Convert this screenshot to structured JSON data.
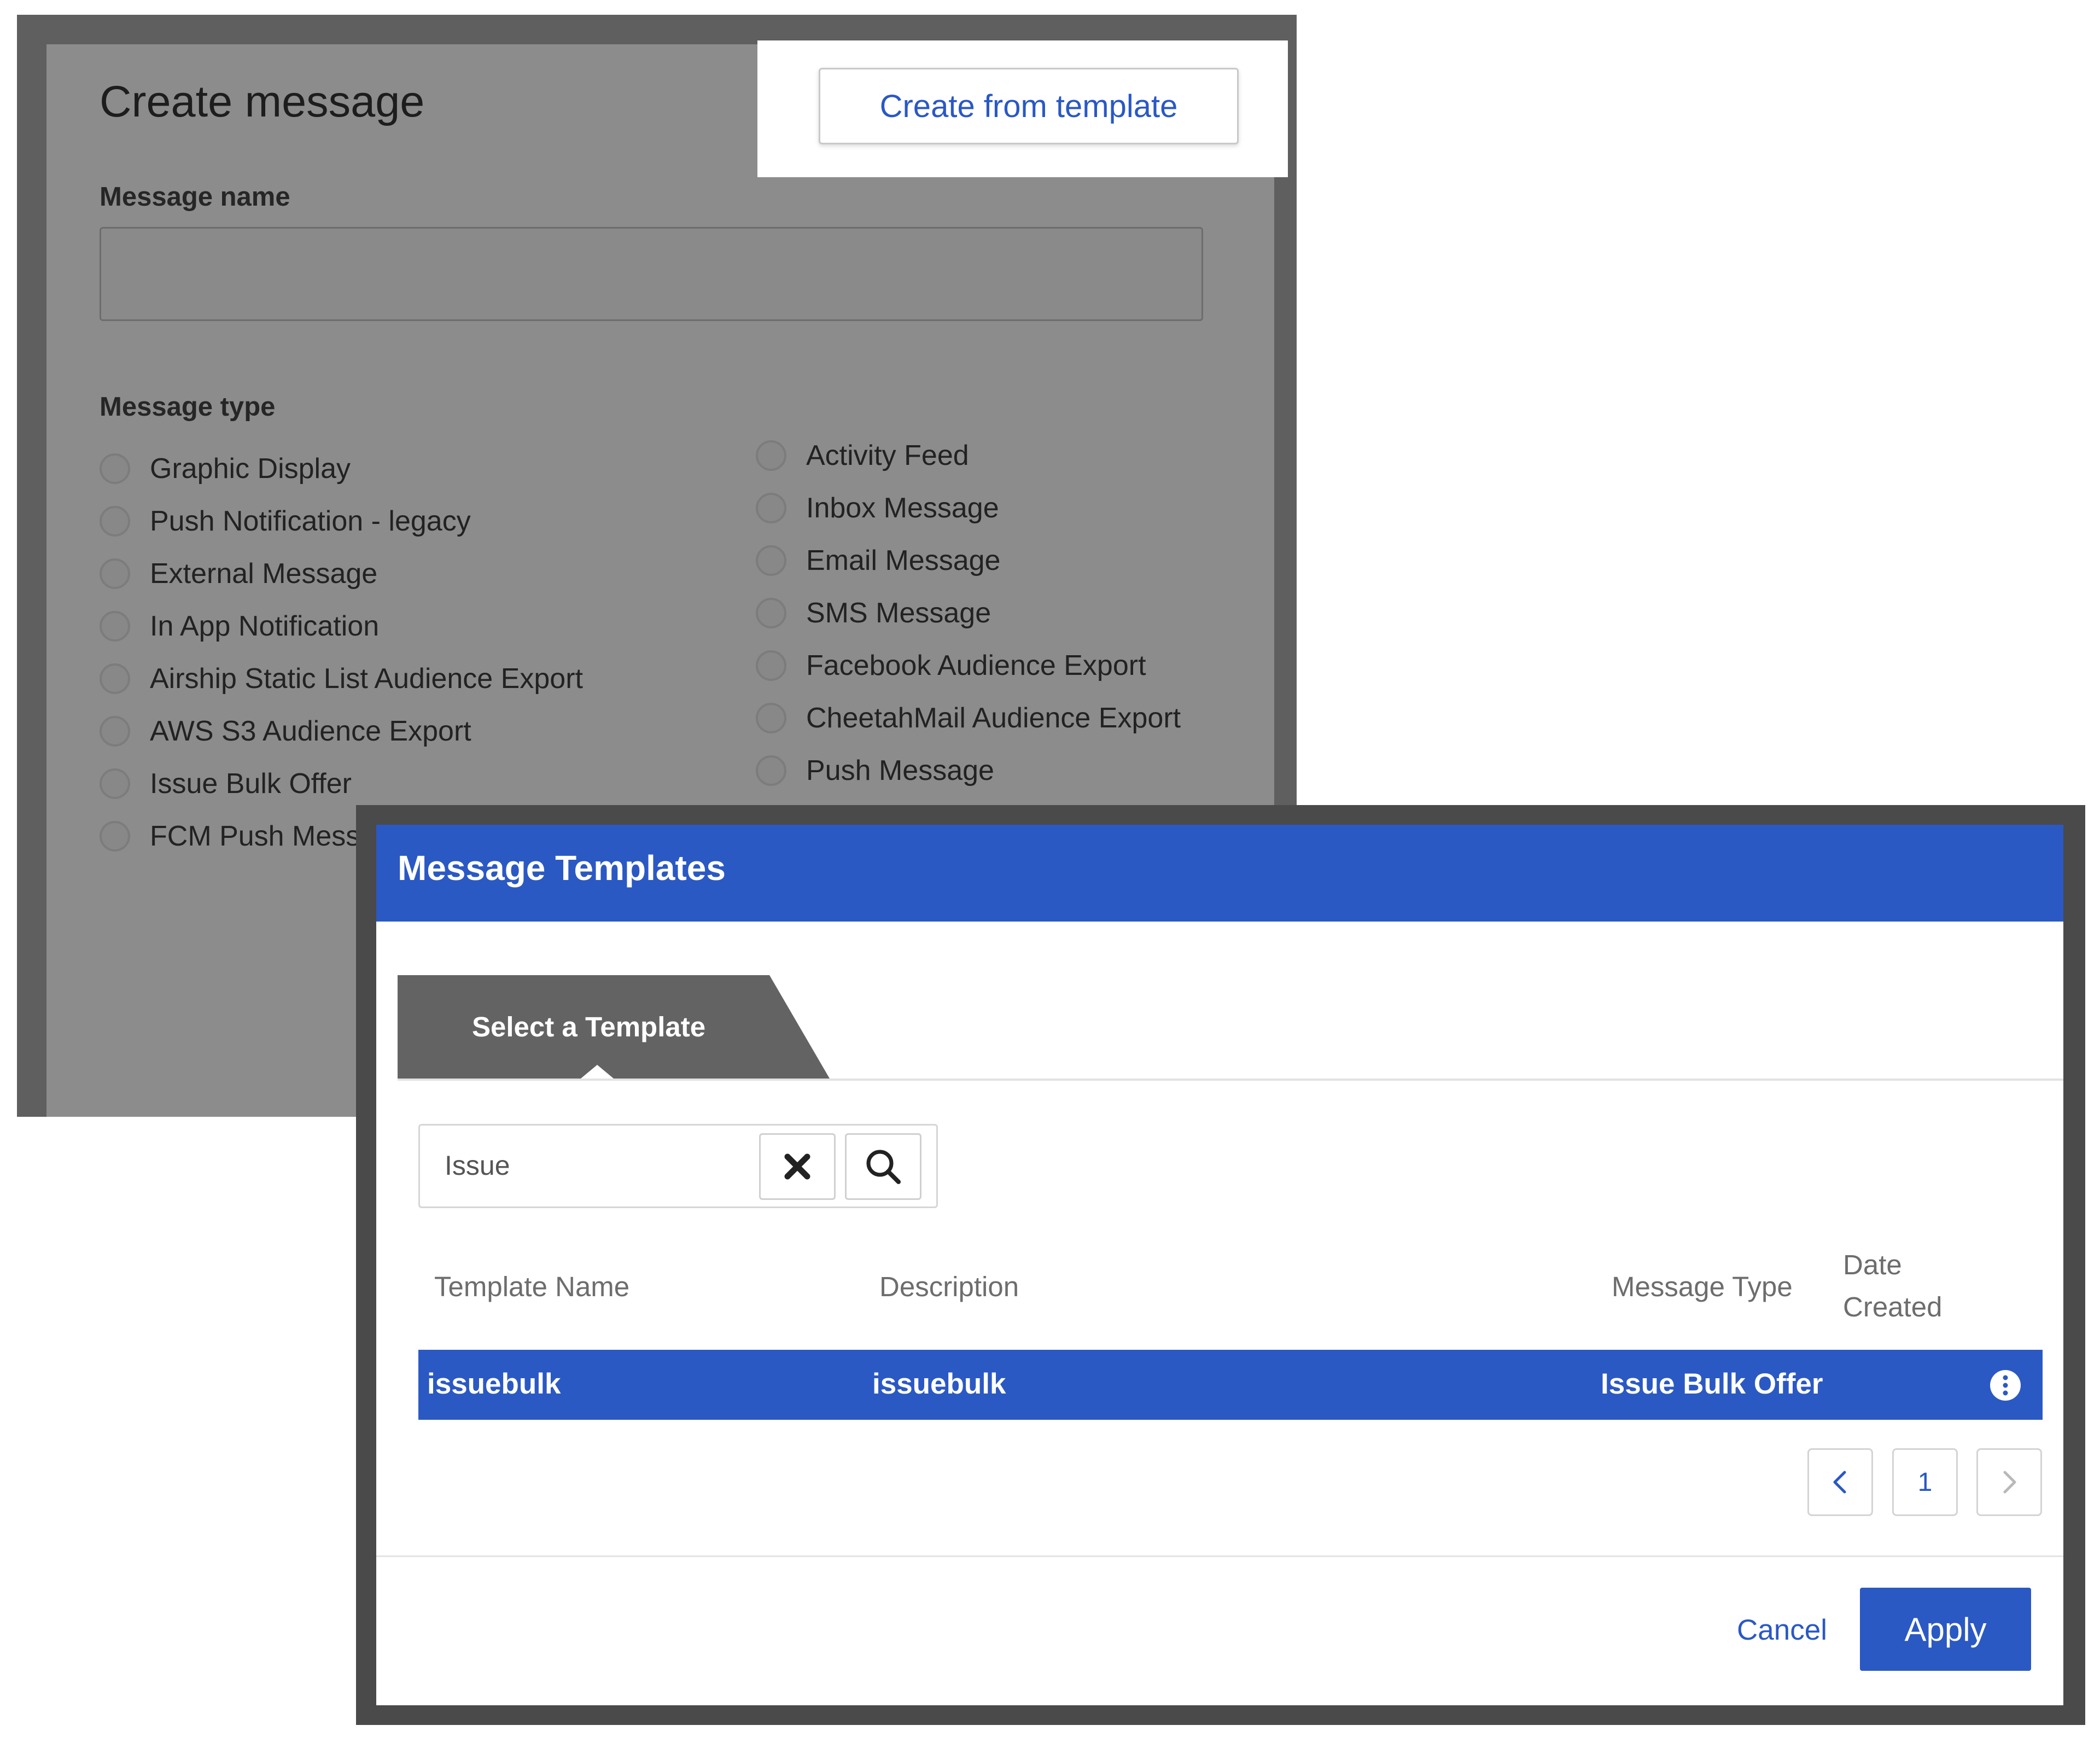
{
  "create_message": {
    "title": "Create message",
    "template_button": "Create from template",
    "name_label": "Message name",
    "name_value": "",
    "type_label": "Message type",
    "types_left": [
      "Graphic Display",
      "Push Notification - legacy",
      "External Message",
      "In App Notification",
      "Airship Static List Audience Export",
      "AWS S3 Audience Export",
      "Issue Bulk Offer",
      "FCM Push Messa"
    ],
    "types_right": [
      "Activity Feed",
      "Inbox Message",
      "Email Message",
      "SMS Message",
      "Facebook Audience Export",
      "CheetahMail Audience Export",
      "Push Message"
    ]
  },
  "modal": {
    "title": "Message Templates",
    "tab_label": "Select a Template",
    "search": {
      "value": "Issue"
    },
    "columns": {
      "template_name": "Template Name",
      "description": "Description",
      "message_type": "Message Type",
      "date_created_line1": "Date",
      "date_created_line2": "Created"
    },
    "rows": [
      {
        "template_name": "issuebulk",
        "description": "issuebulk",
        "message_type": "Issue Bulk Offer"
      }
    ],
    "pagination": {
      "current_page": "1"
    },
    "cancel_label": "Cancel",
    "apply_label": "Apply"
  },
  "colors": {
    "accent_blue": "#2b59c3",
    "overlay_gray": "#8c8c8c",
    "tab_gray": "#636363"
  },
  "icons": [
    "close-icon",
    "search-icon",
    "info-icon",
    "chevron-left-icon",
    "chevron-right-icon"
  ]
}
